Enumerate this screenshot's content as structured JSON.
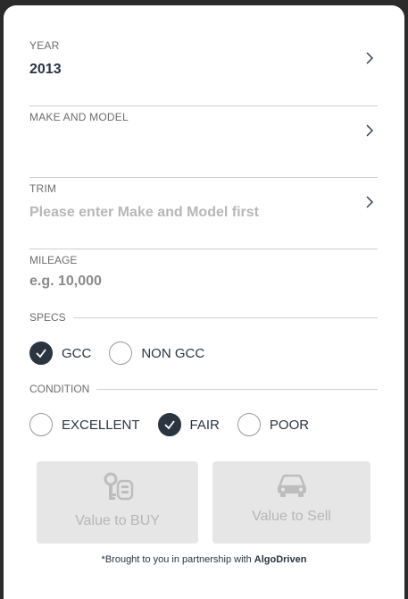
{
  "form": {
    "year": {
      "label": "YEAR",
      "value": "2013"
    },
    "make_model": {
      "label": "MAKE AND MODEL",
      "value": ""
    },
    "trim": {
      "label": "TRIM",
      "placeholder": "Please enter Make and Model first"
    },
    "mileage": {
      "label": "MILEAGE",
      "placeholder": "e.g. 10,000"
    }
  },
  "specs": {
    "label": "SPECS",
    "options": [
      {
        "label": "GCC",
        "selected": true
      },
      {
        "label": "NON GCC",
        "selected": false
      }
    ]
  },
  "condition": {
    "label": "CONDITION",
    "options": [
      {
        "label": "EXCELLENT",
        "selected": false
      },
      {
        "label": "FAIR",
        "selected": true
      },
      {
        "label": "POOR",
        "selected": false
      }
    ]
  },
  "actions": {
    "buy": {
      "label": "Value to BUY",
      "icon": "car-keys-icon"
    },
    "sell": {
      "label": "Value to Sell",
      "icon": "car-icon"
    }
  },
  "footer": {
    "prefix": "*Brought to you in partnership with ",
    "partner": "AlgoDriven"
  },
  "colors": {
    "primary": "#2a3540",
    "divider": "#cfcfcf",
    "button_bg": "#e6e6e6",
    "button_text": "#b6b6b6"
  }
}
